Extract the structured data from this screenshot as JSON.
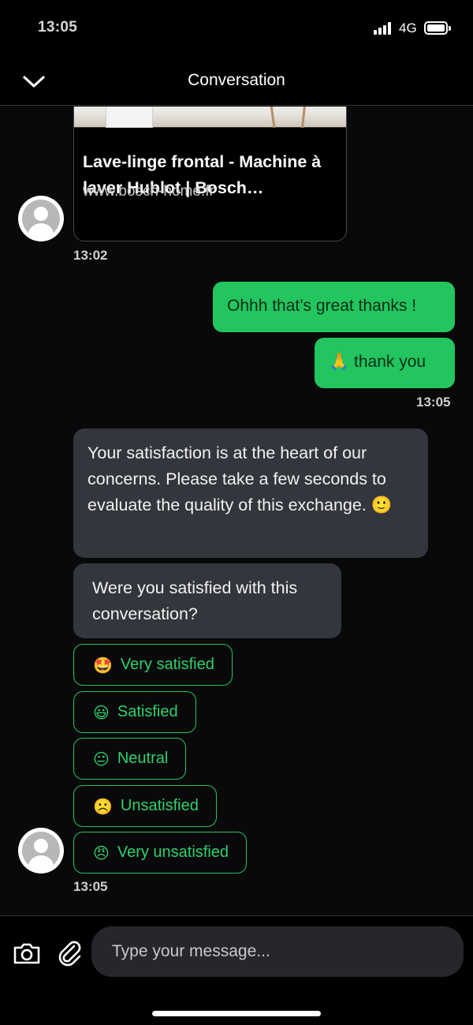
{
  "status_bar": {
    "time": "13:05",
    "network": "4G"
  },
  "header": {
    "title": "Conversation",
    "back_icon": "chevron-down-icon"
  },
  "messages": {
    "link_card": {
      "title": "Lave-linge frontal - Machine à laver Hublot | Bosch Electroménager",
      "url": "www.bosch-home.fr",
      "time": "13:02"
    },
    "outgoing": [
      {
        "text": "Ohhh that’s great thanks !"
      },
      {
        "emoji": "🙏",
        "text": "thank you"
      }
    ],
    "outgoing_time": "13:05",
    "incoming": [
      {
        "text": "Your satisfaction is at the heart of our concerns. Please take a few seconds to evaluate the quality of this exchange. 🙂"
      },
      {
        "text": "Were you satisfied with this conversation?"
      }
    ],
    "quick_replies": [
      {
        "emoji": "🤩",
        "label": "Very satisfied"
      },
      {
        "emoji": "😃",
        "label": "Satisfied"
      },
      {
        "emoji": "😐",
        "label": "Neutral"
      },
      {
        "emoji": "☹️",
        "label": "Unsatisfied"
      },
      {
        "emoji": "😠",
        "label": "Very unsatisfied"
      }
    ],
    "incoming_time": "13:05"
  },
  "composer": {
    "placeholder": "Type your message...",
    "camera_icon": "camera-icon",
    "attach_icon": "paperclip-icon"
  },
  "colors": {
    "accent": "#22c55e",
    "incoming_bubble": "#34363d",
    "background": "#000000"
  }
}
